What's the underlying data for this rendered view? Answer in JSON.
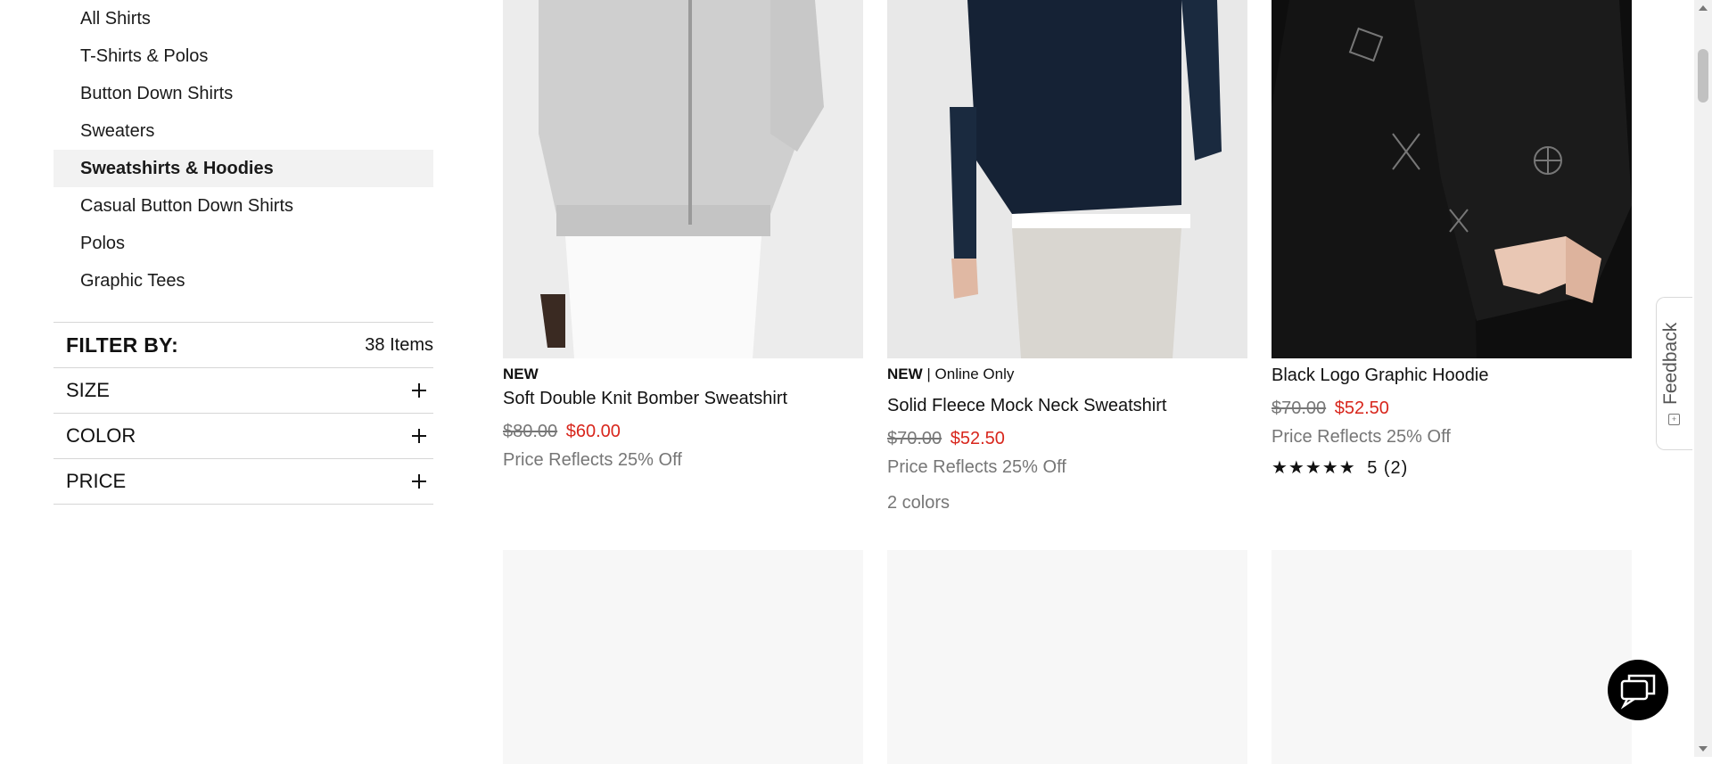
{
  "categories": [
    {
      "label": "All Shirts",
      "active": false
    },
    {
      "label": "T-Shirts & Polos",
      "active": false
    },
    {
      "label": "Button Down Shirts",
      "active": false
    },
    {
      "label": "Sweaters",
      "active": false
    },
    {
      "label": "Sweatshirts & Hoodies",
      "active": true
    },
    {
      "label": "Casual Button Down Shirts",
      "active": false
    },
    {
      "label": "Polos",
      "active": false
    },
    {
      "label": "Graphic Tees",
      "active": false
    }
  ],
  "filter": {
    "title": "FILTER BY:",
    "count": "38 Items",
    "facets": [
      "SIZE",
      "COLOR",
      "PRICE"
    ]
  },
  "products": [
    {
      "flag": "NEW",
      "flag_sub": "",
      "name": "Soft Double Knit Bomber Sweatshirt",
      "old_price": "$80.00",
      "price": "$60.00",
      "note": "Price Reflects 25% Off"
    },
    {
      "flag": "NEW",
      "flag_sub": " | Online Only",
      "name": "Solid Fleece Mock Neck Sweatshirt",
      "old_price": "$70.00",
      "price": "$52.50",
      "note": "Price Reflects 25% Off",
      "colors": "2 colors"
    },
    {
      "flag": "",
      "name": "Black Logo Graphic Hoodie",
      "old_price": "$70.00",
      "price": "$52.50",
      "note": "Price Reflects 25% Off",
      "rating_stars": "★★★★★",
      "rating": "5 (2)"
    }
  ],
  "feedback": {
    "label": "Feedback"
  },
  "colors": {
    "sale": "#d8261c",
    "active_bg": "#f2f2f2",
    "muted": "#767676"
  }
}
